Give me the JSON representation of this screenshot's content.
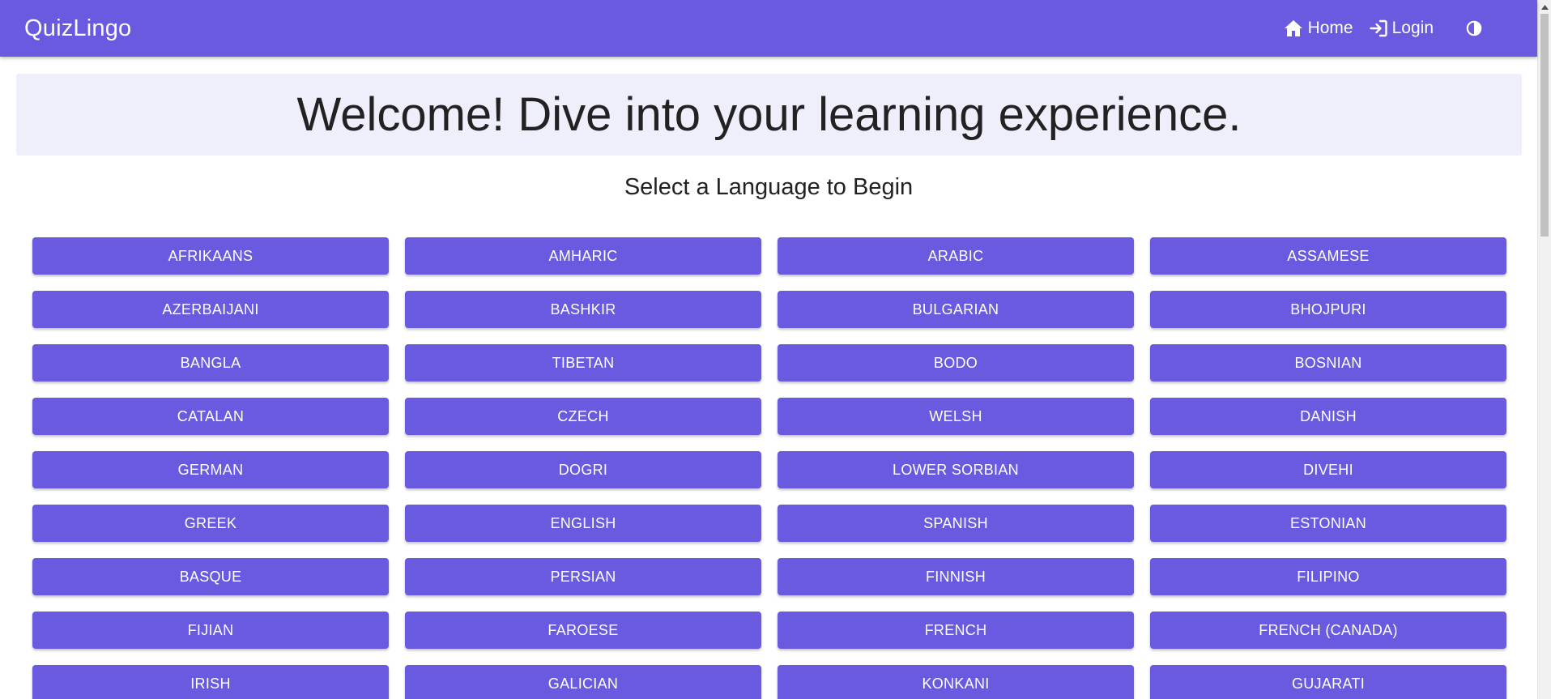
{
  "app": {
    "brand": "QuizLingo",
    "accent_color": "#6a5ae0"
  },
  "nav": {
    "home_label": "Home",
    "home_icon": "home-icon",
    "login_label": "Login",
    "login_icon": "login-icon",
    "theme_icon": "contrast-icon"
  },
  "hero": {
    "title": "Welcome! Dive into your learning experience."
  },
  "subtitle": "Select a Language to Begin",
  "languages": [
    "AFRIKAANS",
    "AMHARIC",
    "ARABIC",
    "ASSAMESE",
    "AZERBAIJANI",
    "BASHKIR",
    "BULGARIAN",
    "BHOJPURI",
    "BANGLA",
    "TIBETAN",
    "BODO",
    "BOSNIAN",
    "CATALAN",
    "CZECH",
    "WELSH",
    "DANISH",
    "GERMAN",
    "DOGRI",
    "LOWER SORBIAN",
    "DIVEHI",
    "GREEK",
    "ENGLISH",
    "SPANISH",
    "ESTONIAN",
    "BASQUE",
    "PERSIAN",
    "FINNISH",
    "FILIPINO",
    "FIJIAN",
    "FAROESE",
    "FRENCH",
    "FRENCH (CANADA)",
    "IRISH",
    "GALICIAN",
    "KONKANI",
    "GUJARATI"
  ]
}
